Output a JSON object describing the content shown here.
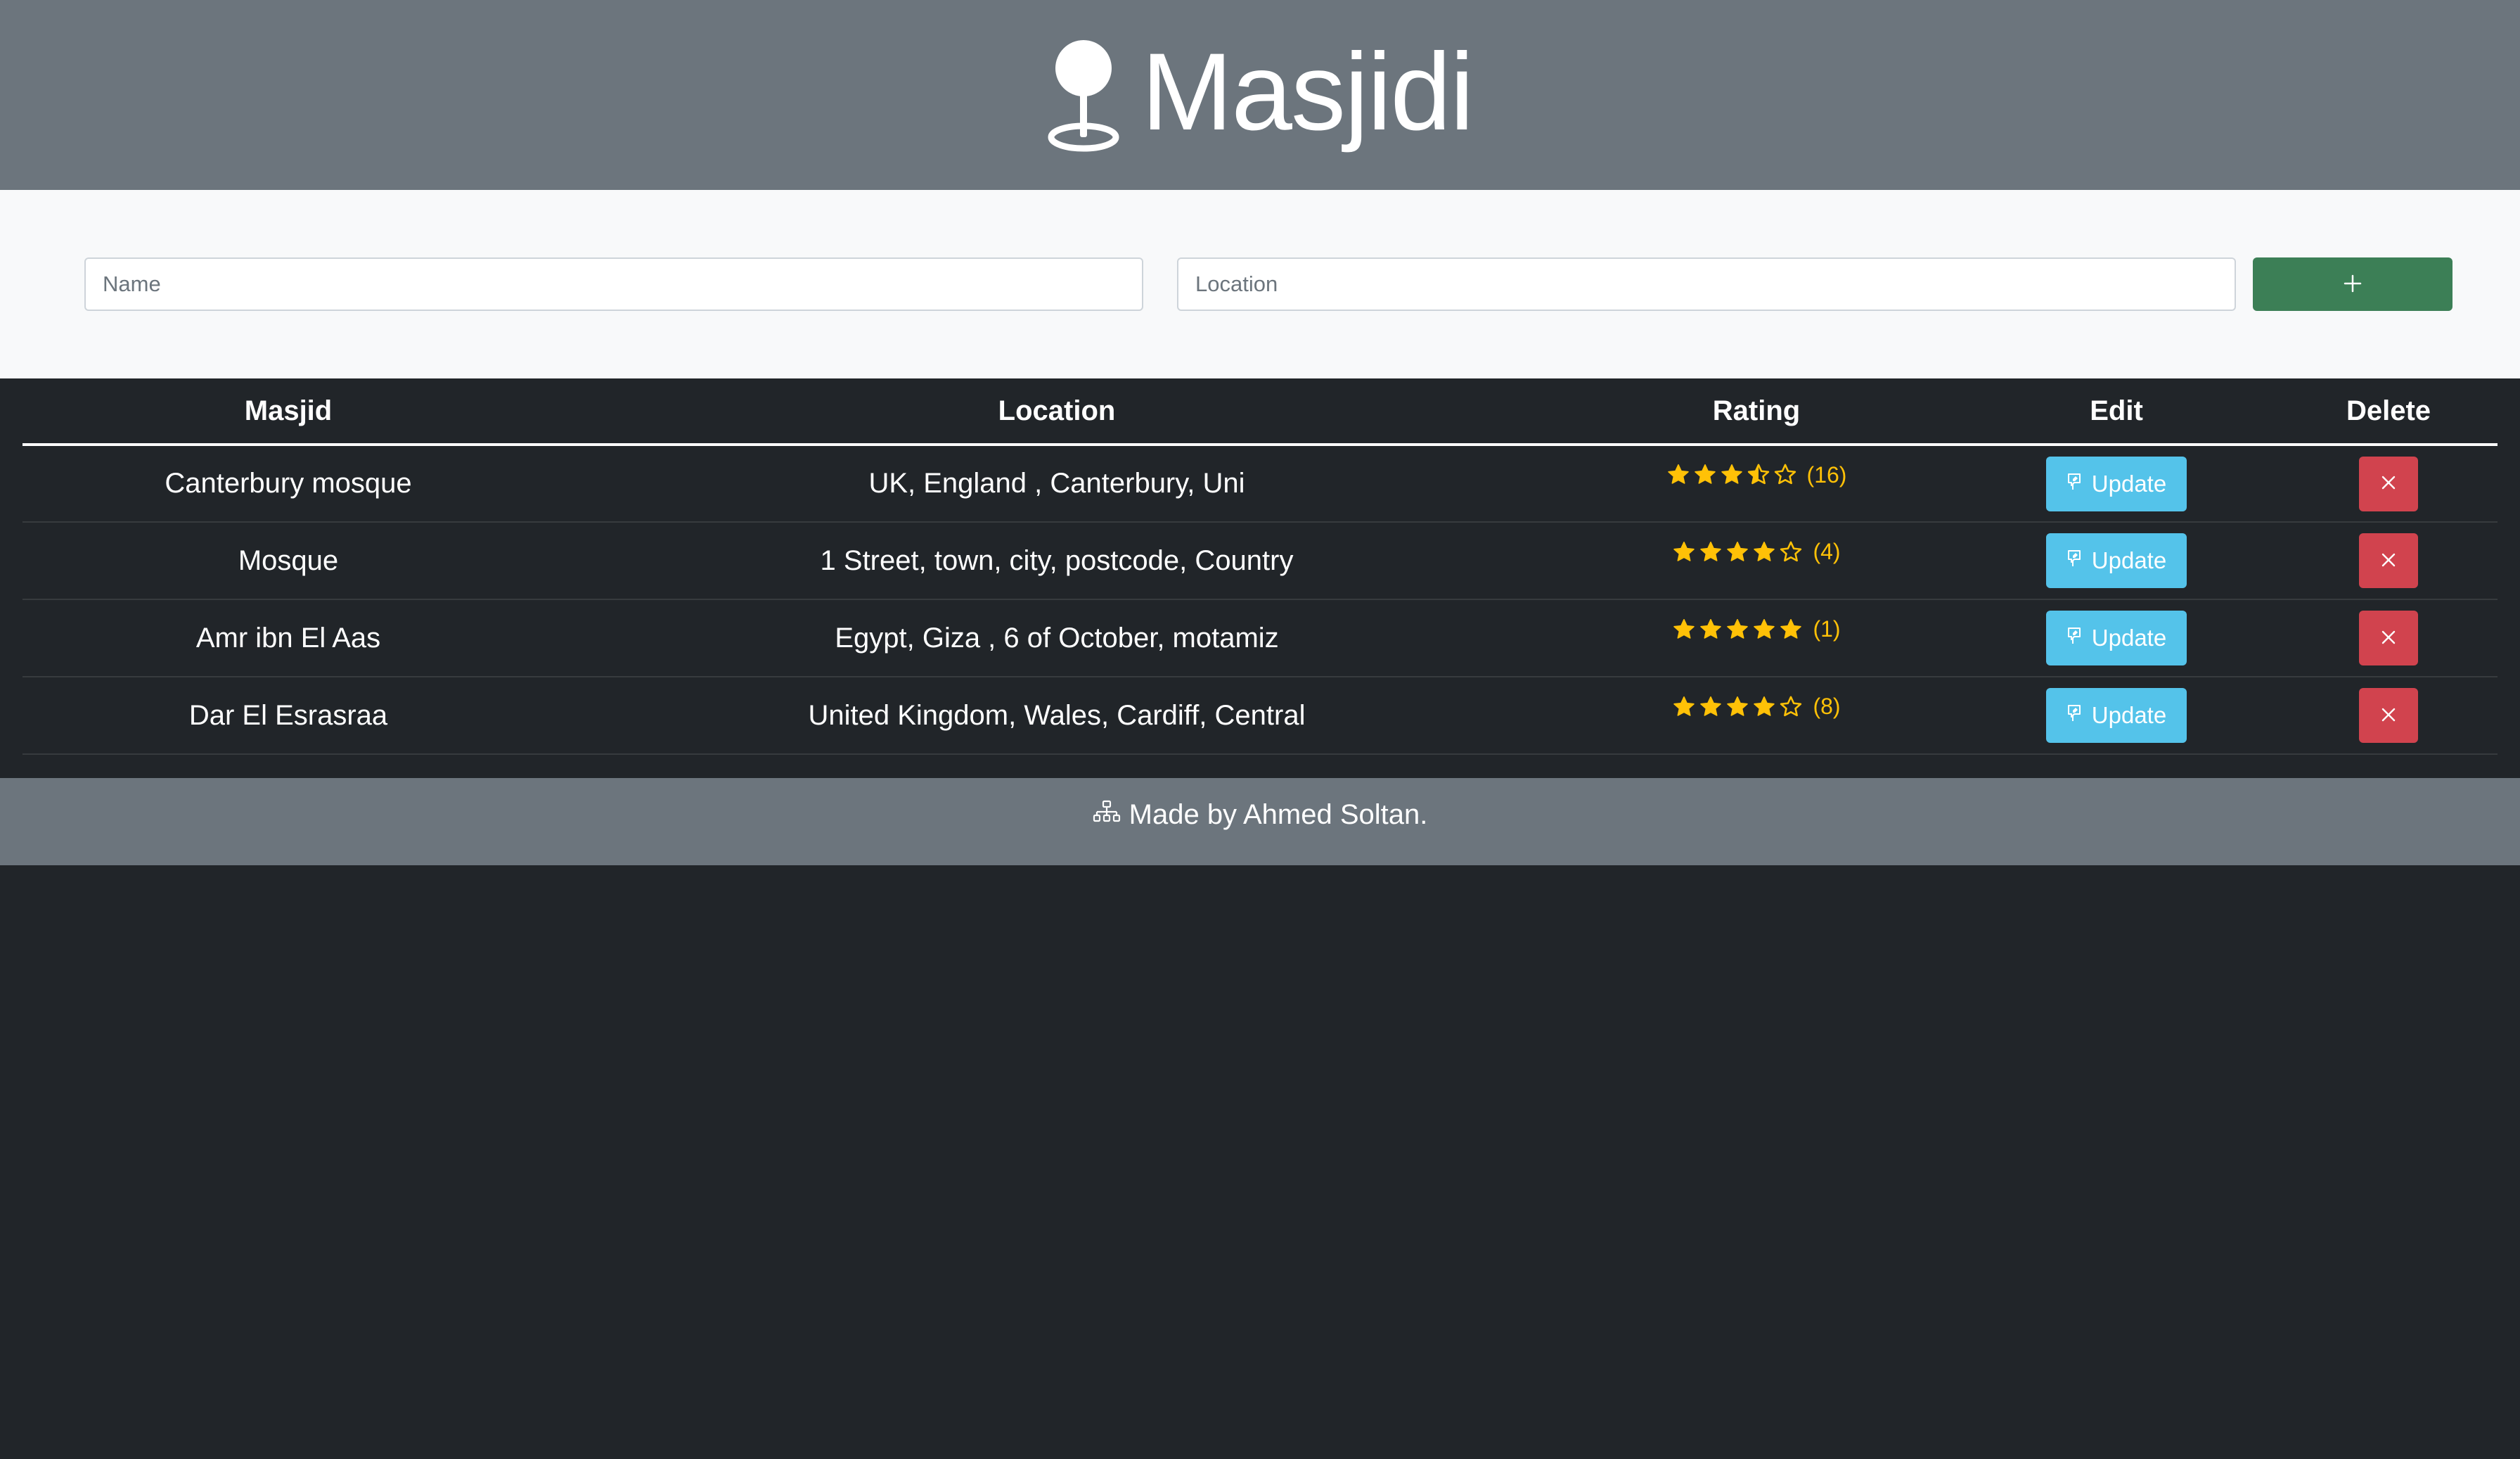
{
  "header": {
    "title": "Masjidi",
    "logo_icon": "map-pin-icon"
  },
  "form": {
    "name_placeholder": "Name",
    "name_value": "",
    "location_placeholder": "Location",
    "location_value": "",
    "add_icon": "plus-icon"
  },
  "table": {
    "columns": [
      "Masjid",
      "Location",
      "Rating",
      "Edit",
      "Delete"
    ],
    "rows": [
      {
        "name": "Canterbury mosque",
        "location": "UK, England , Canterbury, Uni",
        "rating": 3.5,
        "count": "(16)",
        "update_label": "Update"
      },
      {
        "name": "Mosque",
        "location": "1 Street, town, city, postcode, Country",
        "rating": 4,
        "count": "(4)",
        "update_label": "Update"
      },
      {
        "name": "Amr ibn El Aas",
        "location": "Egypt, Giza , 6 of October, motamiz",
        "rating": 5,
        "count": "(1)",
        "update_label": "Update"
      },
      {
        "name": "Dar El Esrasraa",
        "location": "United Kingdom, Wales, Cardiff, Central",
        "rating": 4,
        "count": "(8)",
        "update_label": "Update"
      }
    ]
  },
  "footer": {
    "text": "Made by Ahmed Soltan.",
    "icon": "diagram-icon"
  },
  "colors": {
    "header_bg": "#6c757d",
    "page_bg": "#212529",
    "form_bg": "#f8f9fa",
    "add_button": "#3c7f56",
    "update_button": "#54c3ea",
    "delete_button": "#d1434e",
    "star": "#ffc107"
  }
}
